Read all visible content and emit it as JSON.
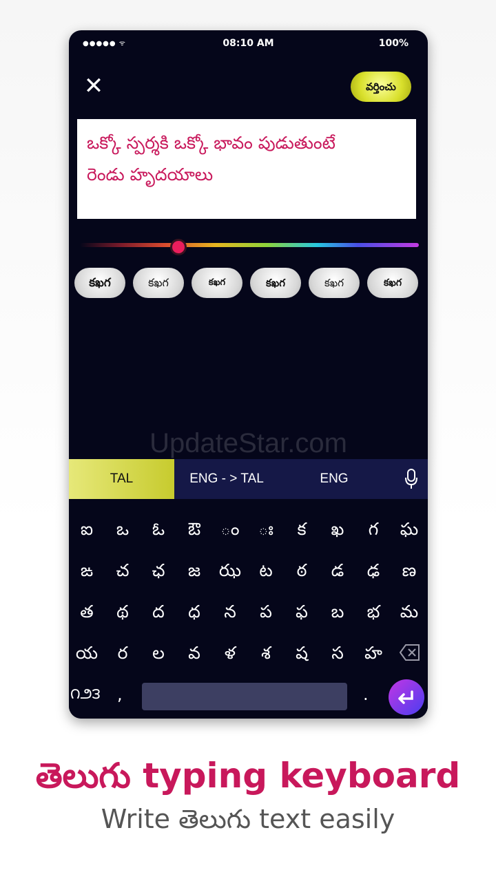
{
  "status_bar": {
    "signal": "●●●●● ᯤ",
    "time": "08:10 AM",
    "battery": "100%"
  },
  "header": {
    "close_glyph": "✕",
    "apply_label": "వర్తించు"
  },
  "editor": {
    "line1": "ఒక్కో స్పర్శకి ఒక్కో భావం పుడుతుంటే",
    "line2": "రెండు హృదయాలు",
    "text_color": "#c8185b"
  },
  "color_slider": {
    "value_fraction": 0.29
  },
  "font_styles": [
    "కఖగ",
    "కఖగ",
    "కఖగ",
    "కఖగ",
    "కఖగ",
    "కఖగ"
  ],
  "watermark": "UpdateStar.com",
  "keyboard_tabs": {
    "tal": "TAL",
    "eng_to_tal": "ENG - > TAL",
    "eng": "ENG",
    "active": "TAL"
  },
  "keyboard": {
    "rows": [
      [
        "ఐ",
        "ఒ",
        "ఓ",
        "ఔ",
        "ం",
        "ః",
        "క",
        "ఖ",
        "గ",
        "ఘ"
      ],
      [
        "ఙ",
        "చ",
        "ఛ",
        "జ",
        "ఝ",
        "ట",
        "ఠ",
        "డ",
        "ఢ",
        "ణ"
      ],
      [
        "త",
        "థ",
        "ద",
        "ధ",
        "న",
        "ప",
        "ఫ",
        "బ",
        "భ",
        "మ"
      ],
      [
        "య",
        "ర",
        "ల",
        "వ",
        "ళ",
        "శ",
        "ష",
        "స",
        "హ"
      ]
    ],
    "numbers_key": "౧౨౩",
    "comma_key": ",",
    "dot_key": ".",
    "enter_glyph": "↵"
  },
  "caption": {
    "title": "తెలుగు typing keyboard",
    "subtitle": "Write తెలుగు text easily"
  }
}
